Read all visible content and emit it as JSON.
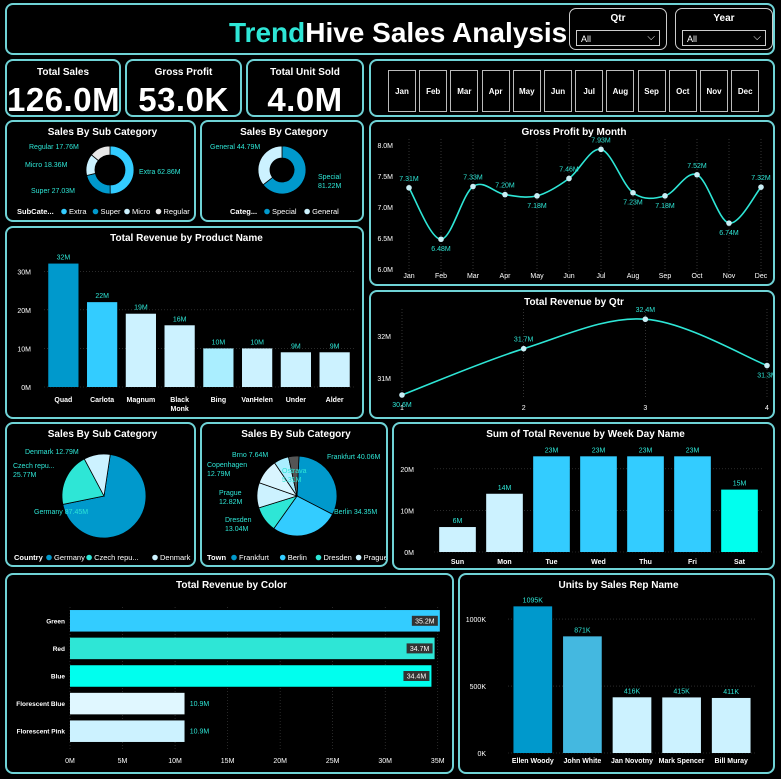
{
  "title": {
    "accent": "Trend",
    "rest": "Hive Sales Analysis"
  },
  "slicers": {
    "qtr": {
      "label": "Qtr",
      "value": "All"
    },
    "year": {
      "label": "Year",
      "value": "All"
    }
  },
  "kpis": {
    "total_sales": {
      "label": "Total Sales",
      "value": "126.0M"
    },
    "gross_profit": {
      "label": "Gross Profit",
      "value": "53.0K"
    },
    "total_units": {
      "label": "Total Unit Sold",
      "value": "4.0M"
    }
  },
  "months": [
    "Jan",
    "Feb",
    "Mar",
    "Apr",
    "May",
    "Jun",
    "Jul",
    "Aug",
    "Sep",
    "Oct",
    "Nov",
    "Dec"
  ],
  "colors": {
    "accent": "#2ee6d6",
    "border": "#6fd3d6",
    "dark_blue": "#0099cc",
    "light_blue": "#33ccff",
    "pale_blue": "#ccf2ff",
    "cyan": "#00ffee"
  },
  "chart_data": [
    {
      "id": "subcat_donut",
      "type": "pie",
      "variant": "donut",
      "title": "Sales By Sub Category",
      "legend_title": "SubCate...",
      "legend": [
        "Extra",
        "Super",
        "Micro",
        "Regular"
      ],
      "categories": [
        "Extra",
        "Super",
        "Micro",
        "Regular"
      ],
      "values": [
        62.86,
        27.03,
        18.36,
        17.76
      ],
      "data_labels": [
        "Extra 62.86M",
        "Super 27.03M",
        "Micro 18.36M",
        "Regular 17.76M"
      ],
      "colors": [
        "#33ccff",
        "#0099cc",
        "#ccf2ff",
        "#e8e8e8"
      ]
    },
    {
      "id": "cat_donut",
      "type": "pie",
      "variant": "donut",
      "title": "Sales By Category",
      "legend_title": "Categ...",
      "legend": [
        "Special",
        "General"
      ],
      "categories": [
        "Special",
        "General"
      ],
      "values": [
        81.22,
        44.79
      ],
      "data_labels": [
        "Special 81.22M",
        "General 44.79M"
      ],
      "colors": [
        "#0099cc",
        "#ccf2ff"
      ]
    },
    {
      "id": "gp_month",
      "type": "line",
      "title": "Gross Profit by Month",
      "categories": [
        "Jan",
        "Feb",
        "Mar",
        "Apr",
        "May",
        "Jun",
        "Jul",
        "Aug",
        "Sep",
        "Oct",
        "Nov",
        "Dec"
      ],
      "values": [
        7.31,
        6.48,
        7.33,
        7.2,
        7.18,
        7.46,
        7.93,
        7.23,
        7.18,
        7.52,
        6.74,
        7.32
      ],
      "data_labels": [
        "7.31M",
        "6.48M",
        "7.33M",
        "7.20M",
        "7.18M",
        "7.46M",
        "7.93M",
        "7.23M",
        "7.18M",
        "7.52M",
        "6.74M",
        "7.32M"
      ],
      "y_ticks": [
        "6.0M",
        "6.5M",
        "7.0M",
        "7.5M",
        "8.0M"
      ],
      "ylim": [
        6.0,
        8.0
      ]
    },
    {
      "id": "rev_product",
      "type": "bar",
      "title": "Total Revenue by Product Name",
      "categories": [
        "Quad",
        "Carlota",
        "Magnum",
        "Black Monk",
        "Bing",
        "VanHelen",
        "Under",
        "Alder"
      ],
      "category_lines": [
        [
          "Quad"
        ],
        [
          "Carlota"
        ],
        [
          "Magnum"
        ],
        [
          "Black",
          "Monk"
        ],
        [
          "Bing"
        ],
        [
          "VanHelen"
        ],
        [
          "Under"
        ],
        [
          "Alder"
        ]
      ],
      "values": [
        32,
        22,
        19,
        16,
        10,
        10,
        9,
        9
      ],
      "data_labels": [
        "32M",
        "22M",
        "19M",
        "16M",
        "10M",
        "10M",
        "9M",
        "9M"
      ],
      "y_ticks": [
        "0M",
        "10M",
        "20M",
        "30M"
      ],
      "ylim": [
        0,
        35
      ],
      "colors": [
        "#0099cc",
        "#33ccff",
        "#ccf2ff",
        "#ccf2ff",
        "#aaeeff",
        "#ccf2ff",
        "#ccf2ff",
        "#ccf2ff"
      ]
    },
    {
      "id": "rev_qtr",
      "type": "line",
      "title": "Total Revenue by Qtr",
      "categories": [
        "1",
        "2",
        "3",
        "4"
      ],
      "values": [
        30.6,
        31.7,
        32.4,
        31.3
      ],
      "data_labels": [
        "30.6M",
        "31.7M",
        "32.4M",
        "31.3M"
      ],
      "y_ticks": [
        "31M",
        "32M"
      ],
      "ylim": [
        30.6,
        32.5
      ]
    },
    {
      "id": "country_pie",
      "type": "pie",
      "title": "Sales By Sub Category",
      "legend_title": "Country",
      "legend": [
        "Germany",
        "Czech repu...",
        "Denmark"
      ],
      "categories": [
        "Germany",
        "Czech repu...",
        "Denmark"
      ],
      "values": [
        87.45,
        25.77,
        12.79
      ],
      "data_labels": [
        "Germany 87.45M",
        "Czech repu... 25.77M",
        "Denmark 12.79M"
      ],
      "colors": [
        "#0099cc",
        "#2ee6d6",
        "#ccf2ff"
      ]
    },
    {
      "id": "town_pie",
      "type": "pie",
      "title": "Sales By Sub Category",
      "legend_title": "Town",
      "legend": [
        "Frankfurt",
        "Berlin",
        "Dresden",
        "Prague"
      ],
      "categories": [
        "Frankfurt",
        "Berlin",
        "Dresden",
        "Prague",
        "Copenhagen",
        "Brno",
        "Ostrava"
      ],
      "values": [
        40.06,
        34.35,
        13.04,
        12.82,
        12.79,
        7.64,
        5.31
      ],
      "data_labels": [
        "Frankfurt 40.06M",
        "Berlin 34.35M",
        "Dresden 13.04M",
        "Prague 12.82M",
        "Copenhagen 12.79M",
        "Brno 7.64M",
        "Ostrava 5.31M"
      ],
      "colors": [
        "#0099cc",
        "#33ccff",
        "#2ee6d6",
        "#ccf2ff",
        "#d9f5ff",
        "#aaeeff",
        "#555555"
      ]
    },
    {
      "id": "rev_weekday",
      "type": "bar",
      "title": "Sum of Total Revenue by Week Day Name",
      "categories": [
        "Sun",
        "Mon",
        "Tue",
        "Wed",
        "Thu",
        "Fri",
        "Sat"
      ],
      "values": [
        6,
        14,
        23,
        23,
        23,
        23,
        15
      ],
      "data_labels": [
        "6M",
        "14M",
        "23M",
        "23M",
        "23M",
        "23M",
        "15M"
      ],
      "y_ticks": [
        "0M",
        "10M",
        "20M"
      ],
      "ylim": [
        0,
        25
      ],
      "colors": [
        "#ccf2ff",
        "#ccf2ff",
        "#33ccff",
        "#33ccff",
        "#33ccff",
        "#33ccff",
        "#00ffee"
      ]
    },
    {
      "id": "rev_color",
      "type": "bar",
      "orientation": "horizontal",
      "title": "Total Revenue by Color",
      "categories": [
        "Green",
        "Red",
        "Blue",
        "Florescent Blue",
        "Florescent Pink"
      ],
      "values": [
        35.2,
        34.7,
        34.4,
        10.9,
        10.9
      ],
      "data_labels": [
        "35.2M",
        "34.7M",
        "34.4M",
        "10.9M",
        "10.9M"
      ],
      "x_ticks": [
        "0M",
        "5M",
        "10M",
        "15M",
        "20M",
        "25M",
        "30M",
        "35M"
      ],
      "xlim": [
        0,
        35.5
      ],
      "colors": [
        "#33ccff",
        "#2ee6d6",
        "#00ffee",
        "#e0f7ff",
        "#ccf2ff"
      ]
    },
    {
      "id": "units_rep",
      "type": "bar",
      "title": "Units by Sales Rep Name",
      "categories": [
        "Ellen Woody",
        "John White",
        "Jan Novotny",
        "Mark Spencer",
        "Bill Muray"
      ],
      "values": [
        1095,
        871,
        416,
        415,
        411
      ],
      "data_labels": [
        "1095K",
        "871K",
        "416K",
        "415K",
        "411K"
      ],
      "y_ticks": [
        "0K",
        "500K",
        "1000K"
      ],
      "ylim": [
        0,
        1150
      ],
      "colors": [
        "#0099cc",
        "#44b8e0",
        "#ccf2ff",
        "#ccf2ff",
        "#ccf2ff"
      ]
    }
  ]
}
